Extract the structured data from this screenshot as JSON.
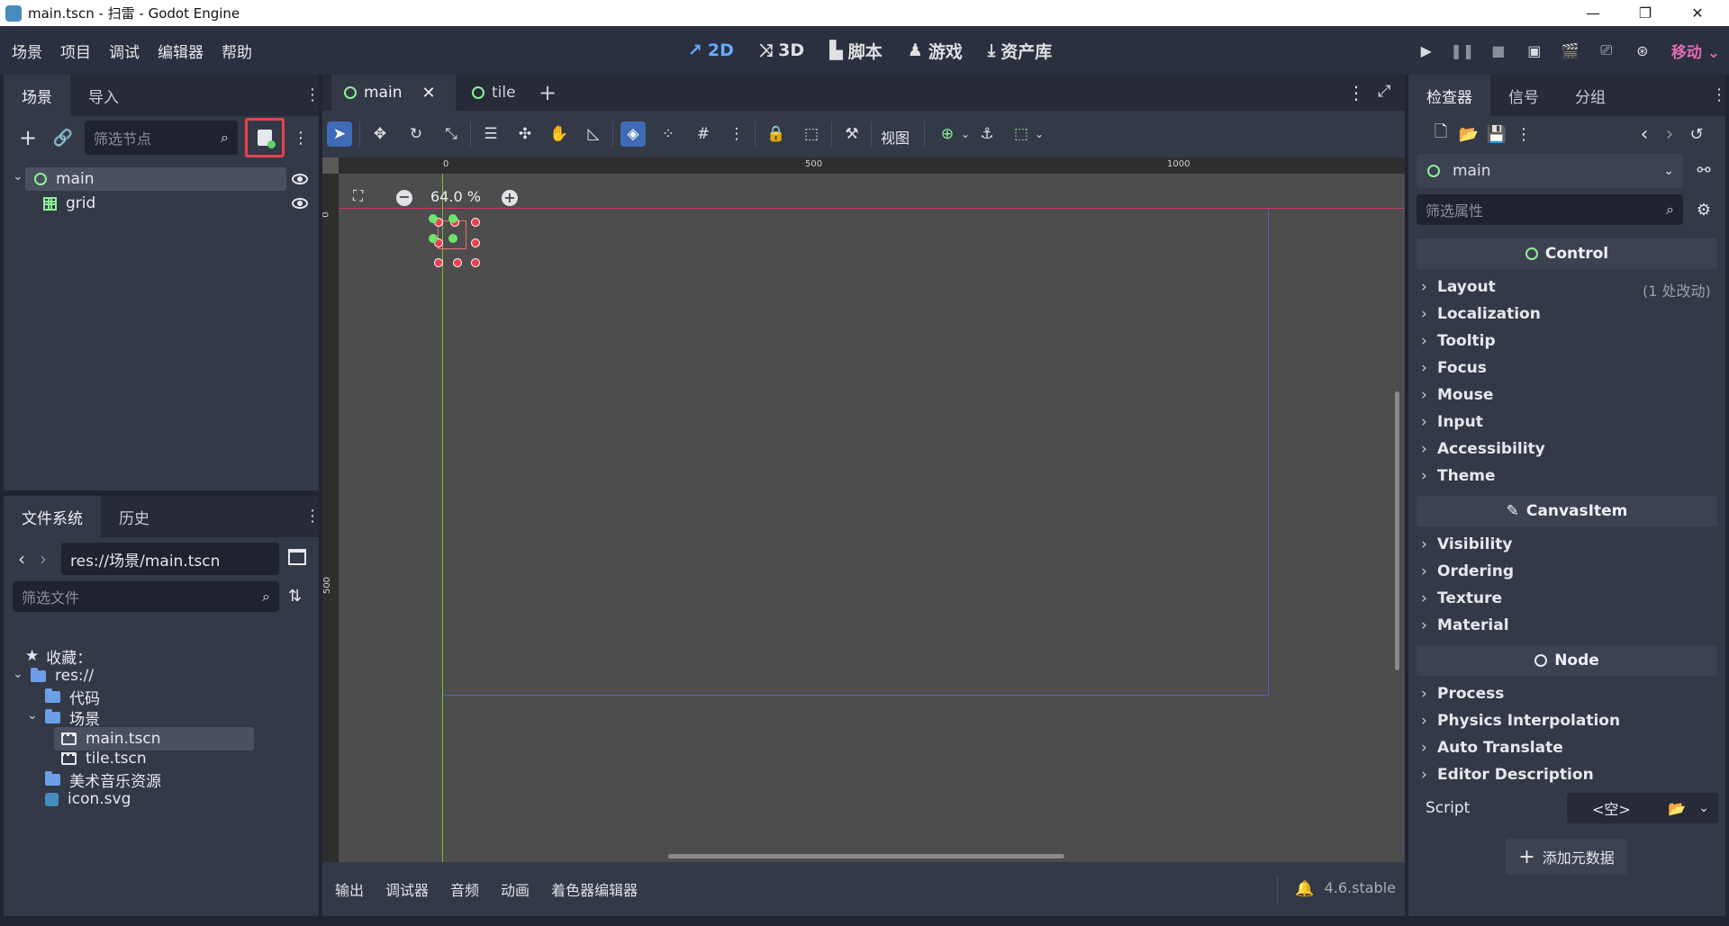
{
  "window": {
    "title": "main.tscn - 扫雷 - Godot Engine"
  },
  "menu": {
    "items": [
      "场景",
      "项目",
      "调试",
      "编辑器",
      "帮助"
    ]
  },
  "workspaces": {
    "items": [
      "2D",
      "3D",
      "脚本",
      "游戏",
      "资产库"
    ],
    "active": "2D"
  },
  "renderer": {
    "label": "移动"
  },
  "scene_dock": {
    "tabs": [
      "场景",
      "导入"
    ],
    "filter_placeholder": "筛选节点",
    "nodes": [
      {
        "label": "main",
        "icon": "control-node-icon"
      },
      {
        "label": "grid",
        "icon": "gridcontainer-icon"
      }
    ]
  },
  "file_dock": {
    "tabs": [
      "文件系统",
      "历史"
    ],
    "path": "res://场景/main.tscn",
    "filter_placeholder": "筛选文件",
    "favorites_label": "收藏：",
    "items": {
      "root": "res://",
      "code": "代码",
      "scenes": "场景",
      "main": "main.tscn",
      "tile": "tile.tscn",
      "assets": "美术音乐资源",
      "icon": "icon.svg"
    }
  },
  "editor_tabs": {
    "tabs": [
      "main",
      "tile"
    ]
  },
  "toolbar": {
    "view_label": "视图"
  },
  "viewport": {
    "zoom": "64.0 %",
    "ruler_h": [
      "0",
      "500",
      "1000"
    ],
    "ruler_v": [
      "0",
      "500"
    ]
  },
  "bottom_panel": {
    "items": [
      "输出",
      "调试器",
      "音频",
      "动画",
      "着色器编辑器"
    ],
    "version": "4.6.stable"
  },
  "inspector": {
    "tabs": [
      "检查器",
      "信号",
      "分组"
    ],
    "object_name": "main",
    "filter_placeholder": "筛选属性",
    "sections": {
      "control": "Control",
      "canvas_item": "CanvasItem",
      "node": "Node"
    },
    "control_props": [
      "Layout",
      "Localization",
      "Tooltip",
      "Focus",
      "Mouse",
      "Input",
      "Accessibility",
      "Theme"
    ],
    "layout_note": "(1 处改动)",
    "canvas_props": [
      "Visibility",
      "Ordering",
      "Texture",
      "Material"
    ],
    "node_props": [
      "Process",
      "Physics Interpolation",
      "Auto Translate",
      "Editor Description"
    ],
    "script_label": "Script",
    "script_value": "<空>",
    "add_metadata": "添加元数据"
  }
}
